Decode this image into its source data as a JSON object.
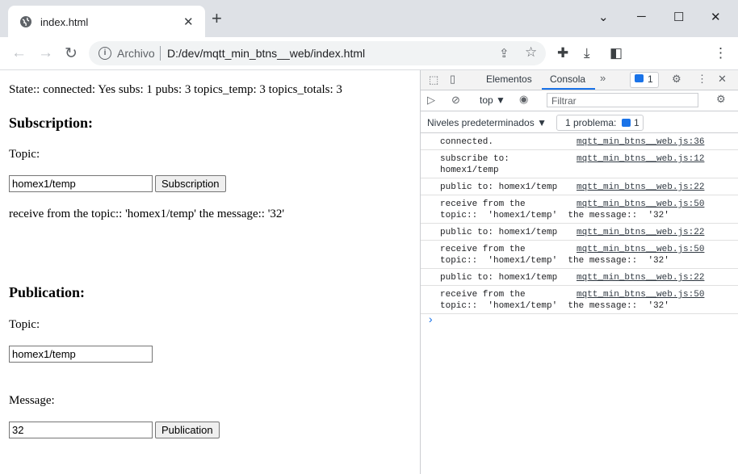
{
  "browser": {
    "tab_title": "index.html",
    "new_tab": "+",
    "window_controls": [
      "⌄",
      "─",
      "☐",
      "✕"
    ],
    "url_scheme": "Archivo",
    "url": "D:/dev/mqtt_min_btns__web/index.html"
  },
  "page": {
    "state_line": "State:: connected: Yes subs: 1 pubs: 3 topics_temp: 3 topics_totals: 3",
    "subscription": {
      "heading": "Subscription:",
      "topic_label": "Topic:",
      "topic_value": "homex1/temp",
      "button": "Subscription",
      "received": "receive from the topic:: 'homex1/temp' the message:: '32'"
    },
    "publication": {
      "heading": "Publication:",
      "topic_label": "Topic:",
      "topic_value": "homex1/temp",
      "message_label": "Message:",
      "message_value": "32",
      "button": "Publication"
    }
  },
  "devtools": {
    "tabs": [
      "Elementos",
      "Consola"
    ],
    "active_tab": "Consola",
    "issues_count": "1",
    "context": "top ▼",
    "filter_placeholder": "Filtrar",
    "levels": "Niveles predeterminados ▼",
    "problem_label": "1 problema:",
    "problem_count": "1",
    "logs": [
      {
        "msg": "connected.",
        "src": "mqtt_min_btns__web.js:36"
      },
      {
        "msg": "subscribe to:\nhomex1/temp",
        "src": "mqtt_min_btns__web.js:12"
      },
      {
        "msg": "public to: homex1/temp",
        "src": "mqtt_min_btns__web.js:22"
      },
      {
        "msg": "receive from the\ntopic::  'homex1/temp'  the message::  '32'",
        "src": "mqtt_min_btns__web.js:50"
      },
      {
        "msg": "public to: homex1/temp",
        "src": "mqtt_min_btns__web.js:22"
      },
      {
        "msg": "receive from the\ntopic::  'homex1/temp'  the message::  '32'",
        "src": "mqtt_min_btns__web.js:50"
      },
      {
        "msg": "public to: homex1/temp",
        "src": "mqtt_min_btns__web.js:22"
      },
      {
        "msg": "receive from the\ntopic::  'homex1/temp'  the message::  '32'",
        "src": "mqtt_min_btns__web.js:50"
      }
    ],
    "prompt": "›"
  }
}
